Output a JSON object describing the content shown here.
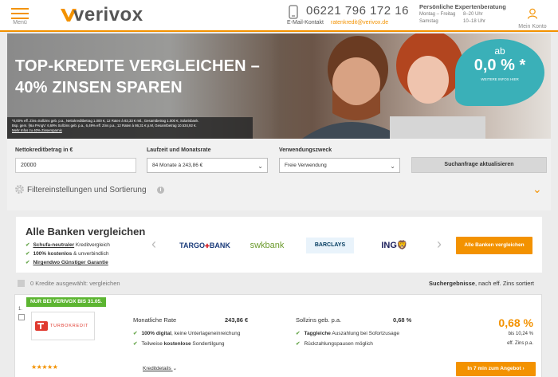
{
  "header": {
    "menu_label": "Menü",
    "logo_text": "verivox",
    "phone": "06221 796 172 16",
    "email_label": "E-Mail-Kontakt",
    "email": "ratenkredit@verivox.de",
    "advice_title": "Persönliche Expertenberatung",
    "hours": [
      {
        "days": "Montag – Freitag",
        "time": "8–20 Uhr"
      },
      {
        "days": "Samstag",
        "time": "10–18 Uhr"
      }
    ],
    "account_label": "Mein Konto"
  },
  "hero": {
    "title_line1": "TOP-KREDITE VERGLEICHEN –",
    "title_line2": "40% ZINSEN SPAREN",
    "fine_print": [
      "*0,00% eff. Zins=Sollzins geb. p.a., Nettokreditbetrag 1.000 €, 12 Raten à 83,33 € mtl., Gesamtbetrag 1.000 €, Solarisbank.",
      "Bsp. gem. §6a PAngV: 6,69% Sollzins geb. p.a., 6,49% eff. Zins p.a., 12 Raten à 86,31 € p.M, Gesamtbetrag 10.534,92 €.",
      "Mehr Infos zu 40% Zinsersparnis"
    ],
    "bubble_ab": "ab",
    "bubble_rate": "0,0 % *",
    "bubble_info": "WEITERE INFOS HIER"
  },
  "form": {
    "amount_label": "Nettokreditbetrag in €",
    "amount_value": "20000",
    "term_label": "Laufzeit und Monatsrate",
    "term_value": "84 Monate à 243,86 €",
    "purpose_label": "Verwendungszweck",
    "purpose_value": "Freie Verwendung",
    "update_button": "Suchanfrage aktualisieren",
    "filter_label": "Filtereinstellungen und Sortierung"
  },
  "compare": {
    "title": "Alle Banken vergleichen",
    "features": [
      {
        "bold": "Schufa-neutraler",
        "rest": " Kreditvergleich"
      },
      {
        "bold": "100% kostenlos",
        "rest": " & unverbindlich"
      },
      {
        "bold": "Nirgendwo Günstiger Garantie",
        "rest": ""
      }
    ],
    "banks": [
      "TARGO",
      "BANK",
      "swkbank",
      "BARCLAYS",
      "ING"
    ],
    "all_banks_button": "Alle Banken vergleichen"
  },
  "results": {
    "selected": "0 Kredite ausgewählt: vergleichen",
    "count_label": "Suchergebnisse",
    "sort_label": ", nach eff. Zins sortiert"
  },
  "offer": {
    "badge": "NUR BEI VERIVOX BIS 31.05.",
    "number": "1.",
    "bank_name": "TURBOKREDIT",
    "monthly_label": "Monatliche Rate",
    "monthly_value": "243,86 €",
    "features_left": [
      {
        "bold": "100% digital",
        "rest": ", keine Unterlageneinreichung"
      },
      {
        "bold": "",
        "pre": "Teilweise ",
        "boldmid": "kostenlose",
        "rest": " Sondertilgung"
      }
    ],
    "interest_label": "Sollzins geb. p.a.",
    "interest_value": "0,68 %",
    "features_right": [
      {
        "bold": "Taggleiche",
        "rest": " Auszahlung bei Sofortzusage"
      },
      {
        "bold": "",
        "rest": "Rückzahlungspausen möglich"
      }
    ],
    "eff_rate": "0,68 %",
    "eff_range": "bis 10,24 %",
    "eff_label": "eff. Zins p.a.",
    "stars": "★★★★★",
    "rating": 5,
    "details_link": "Kreditdetails",
    "offer_button": "In 7 min zum Angebot"
  },
  "colors": {
    "brand": "#f39200",
    "accent": "#3ab0b8",
    "check": "#6aa84f",
    "badge": "#5cb531"
  }
}
